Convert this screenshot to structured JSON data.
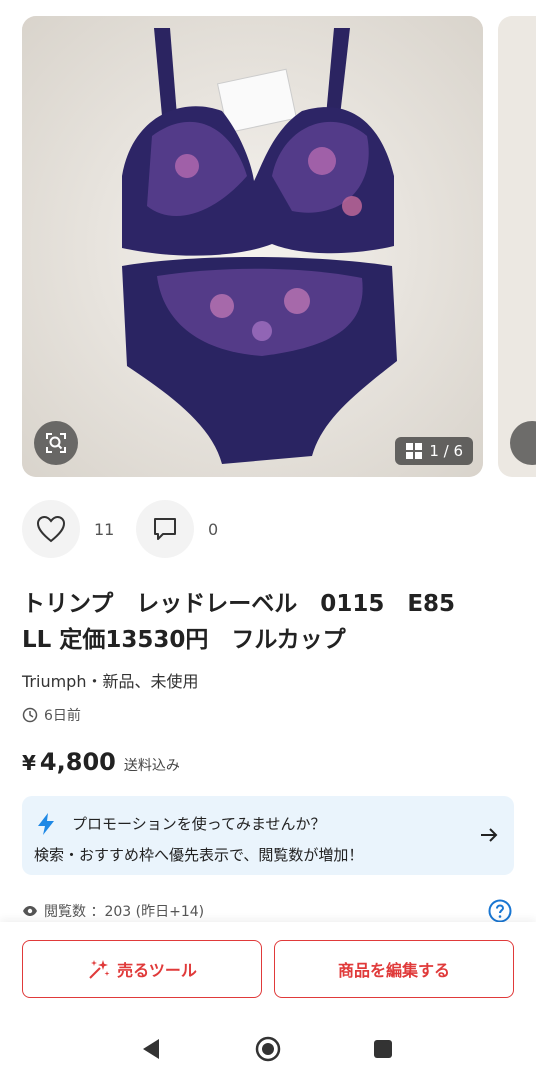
{
  "gallery": {
    "counter": "1 / 6"
  },
  "actions": {
    "likes": "11",
    "comments": "0"
  },
  "item": {
    "title": "トリンプ　レッドレーベル　0115　E85　LL 定価13530円　フルカップ",
    "meta": "Triumph・新品、未使用",
    "posted": "6日前",
    "currency": "¥",
    "price": "4,800",
    "shipping": "送料込み"
  },
  "promo": {
    "title": "プロモーションを使ってみませんか？",
    "subtitle": "検索・おすすめ枠へ優先表示で、閲覧数が増加！"
  },
  "stats": {
    "views": "閲覧数 ：203 (昨日+14)"
  },
  "bottom": {
    "sell_tool": "売るツール",
    "edit": "商品を編集する"
  },
  "colors": {
    "accent": "#e03a3a",
    "promo_bg": "#eaf4fc",
    "promo_icon": "#1e88e5",
    "help": "#1976d2"
  },
  "icons": [
    "search-zoom-icon",
    "grid-icon",
    "heart-icon",
    "comment-icon",
    "clock-icon",
    "lightning-icon",
    "arrow-right-icon",
    "eye-icon",
    "help-icon",
    "sparkle-icon",
    "back-icon",
    "home-icon",
    "recents-icon"
  ]
}
